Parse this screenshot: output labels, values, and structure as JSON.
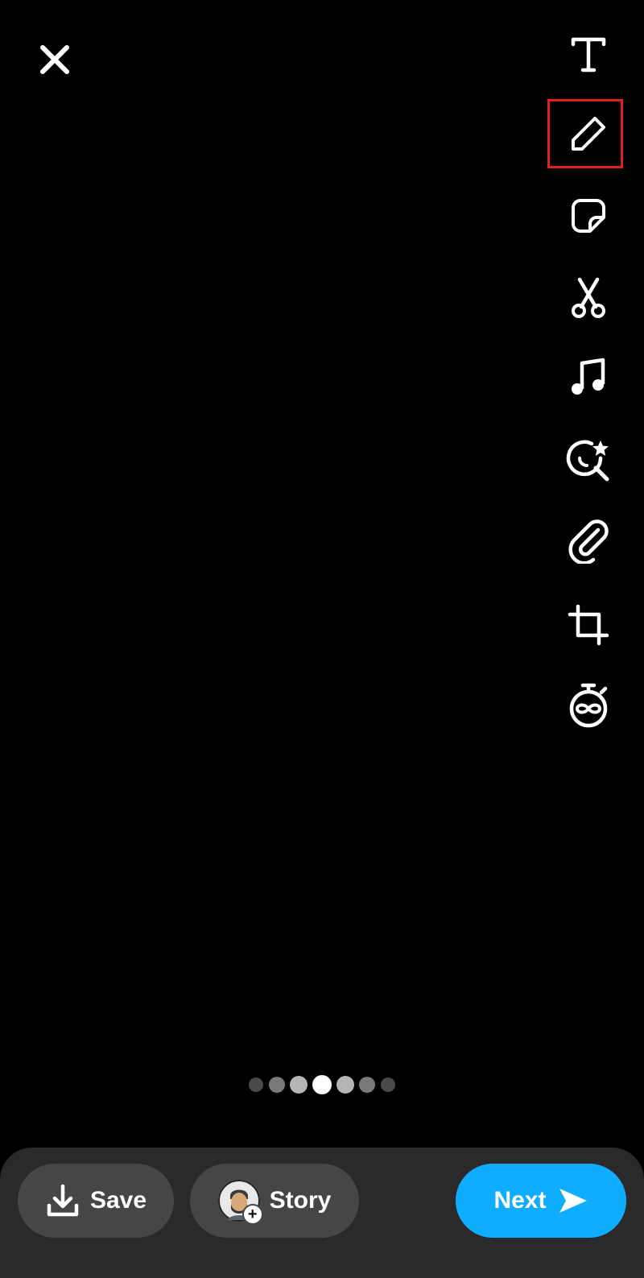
{
  "header": {
    "close_icon": "close-icon"
  },
  "tools": [
    {
      "name": "text",
      "icon": "text-icon"
    },
    {
      "name": "draw",
      "icon": "pencil-icon",
      "highlighted": true
    },
    {
      "name": "sticker",
      "icon": "sticker-icon"
    },
    {
      "name": "scissors",
      "icon": "scissors-icon"
    },
    {
      "name": "music",
      "icon": "music-note-icon"
    },
    {
      "name": "lens",
      "icon": "magnifier-star-icon"
    },
    {
      "name": "attach",
      "icon": "paperclip-icon"
    },
    {
      "name": "crop",
      "icon": "crop-icon"
    },
    {
      "name": "timer",
      "icon": "stopwatch-infinity-icon"
    }
  ],
  "colors": {
    "highlight": "#e0201c",
    "next_button": "#0eadff",
    "secondary_button": "#464646",
    "bottom_bar": "#2a2a2a"
  },
  "pager": {
    "count": 7,
    "active_index": 3
  },
  "actions": {
    "save_label": "Save",
    "story_label": "Story",
    "next_label": "Next"
  }
}
